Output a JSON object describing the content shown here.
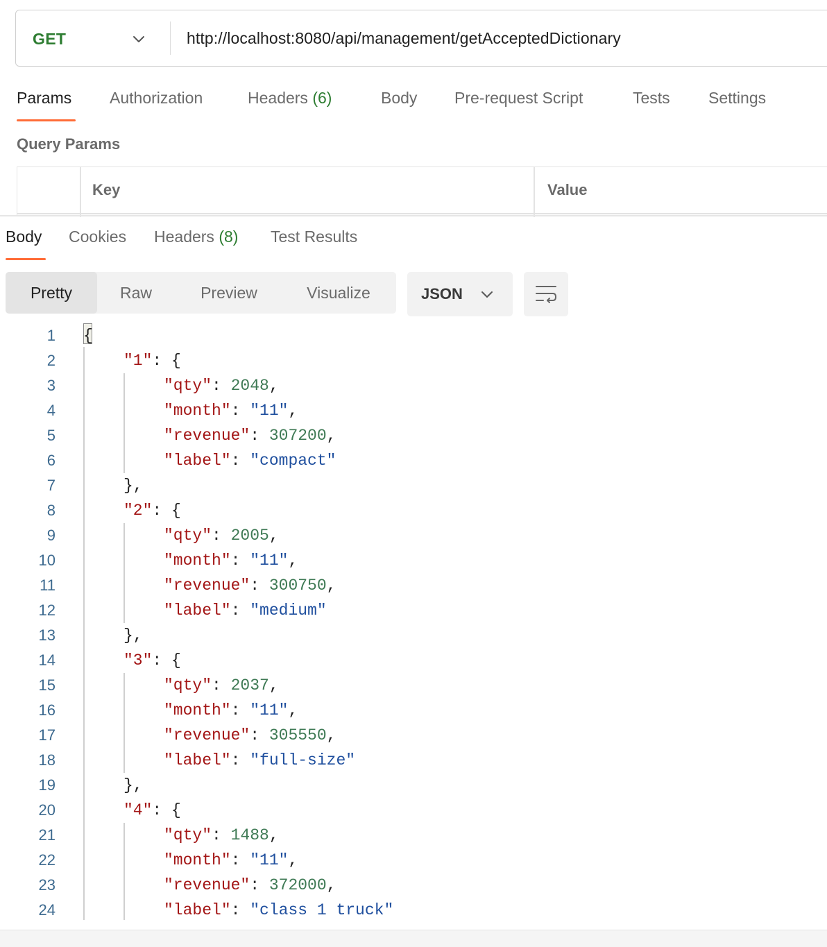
{
  "request": {
    "method": "GET",
    "url": "http://localhost:8080/api/management/getAcceptedDictionary"
  },
  "request_tabs": {
    "params": "Params",
    "authorization": "Authorization",
    "headers": "Headers",
    "headers_count": "(6)",
    "body": "Body",
    "pre_request": "Pre-request Script",
    "tests": "Tests",
    "settings": "Settings"
  },
  "query_params": {
    "title": "Query Params",
    "key_header": "Key",
    "value_header": "Value"
  },
  "response_tabs": {
    "body": "Body",
    "cookies": "Cookies",
    "headers": "Headers",
    "headers_count": "(8)",
    "test_results": "Test Results"
  },
  "view_modes": {
    "pretty": "Pretty",
    "raw": "Raw",
    "preview": "Preview",
    "visualize": "Visualize",
    "format": "JSON"
  },
  "icons": {
    "method_dropdown": "chevron-down-icon",
    "format_dropdown": "chevron-down-icon",
    "wrap": "wrap-lines-icon"
  },
  "colors": {
    "accent": "#ff6c37",
    "method_get": "#2e7d32",
    "json_key": "#a31515",
    "json_number": "#3f7a55",
    "json_string": "#1f4f9e"
  },
  "code_lines": [
    "{",
    "\"1\": {",
    "\"qty\": 2048,",
    "\"month\": \"11\",",
    "\"revenue\": 307200,",
    "\"label\": \"compact\"",
    "},",
    "\"2\": {",
    "\"qty\": 2005,",
    "\"month\": \"11\",",
    "\"revenue\": 300750,",
    "\"label\": \"medium\"",
    "},",
    "\"3\": {",
    "\"qty\": 2037,",
    "\"month\": \"11\",",
    "\"revenue\": 305550,",
    "\"label\": \"full-size\"",
    "},",
    "\"4\": {",
    "\"qty\": 1488,",
    "\"month\": \"11\",",
    "\"revenue\": 372000,",
    "\"label\": \"class 1 truck\""
  ]
}
